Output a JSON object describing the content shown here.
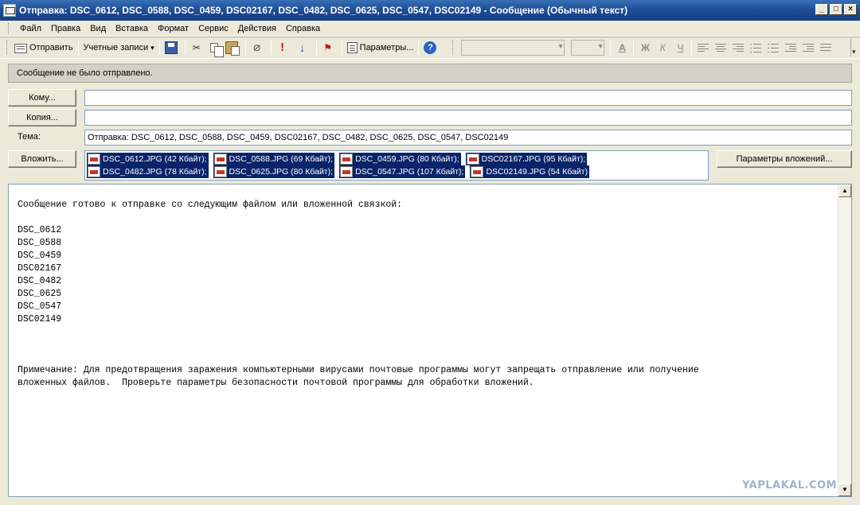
{
  "window": {
    "title": "Отправка: DSC_0612, DSC_0588, DSC_0459, DSC02167, DSC_0482, DSC_0625, DSC_0547, DSC02149 - Сообщение (Обычный текст)",
    "minimize": "_",
    "maximize": "□",
    "close": "×"
  },
  "menu": [
    "Файл",
    "Правка",
    "Вид",
    "Вставка",
    "Формат",
    "Сервис",
    "Действия",
    "Справка"
  ],
  "toolbar": {
    "send_label": "Отправить",
    "accounts_label": "Учетные записи",
    "params_label": "Параметры...",
    "help_label": "?",
    "format": {
      "font_color": "A",
      "bold": "Ж",
      "italic": "К",
      "underline": "Ч"
    }
  },
  "infobar": {
    "text": "Сообщение не было отправлено."
  },
  "fields": {
    "to_label": "Кому...",
    "to_value": "",
    "cc_label": "Копия...",
    "cc_value": "",
    "subject_label": "Тема:",
    "subject_value": "Отправка: DSC_0612, DSC_0588, DSC_0459, DSC02167, DSC_0482, DSC_0625, DSC_0547, DSC02149",
    "attach_label": "Вложить...",
    "attach_params_label": "Параметры вложений..."
  },
  "attachments": [
    {
      "name": "DSC_0612.JPG (42 Кбайт);"
    },
    {
      "name": "DSC_0588.JPG (69 Кбайт);"
    },
    {
      "name": "DSC_0459.JPG (80 Кбайт);"
    },
    {
      "name": "DSC02167.JPG (95 Кбайт);"
    },
    {
      "name": "DSC_0482.JPG (78 Кбайт);"
    },
    {
      "name": "DSC_0625.JPG (80 Кбайт);"
    },
    {
      "name": "DSC_0547.JPG (107 Кбайт);"
    },
    {
      "name": "DSC02149.JPG (54 Кбайт)"
    }
  ],
  "body": {
    "intro": "Сообщение готово к отправке со следующим файлом или вложенной связкой:",
    "files": [
      "DSC_0612",
      "DSC_0588",
      "DSC_0459",
      "DSC02167",
      "DSC_0482",
      "DSC_0625",
      "DSC_0547",
      "DSC02149"
    ],
    "note_line1": "Примечание: Для предотвращения заражения компьютерными вирусами почтовые программы могут запрещать отправление или получение",
    "note_line2": "вложенных файлов.  Проверьте параметры безопасности почтовой программы для обработки вложений."
  },
  "watermark": "YAPLAKAL.COM"
}
